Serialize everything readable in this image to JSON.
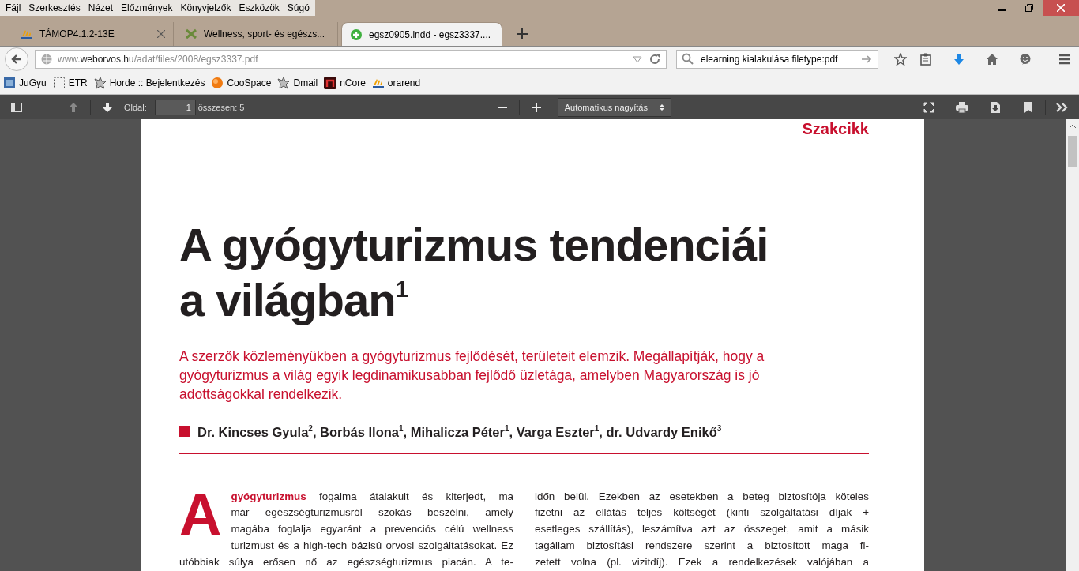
{
  "menu": [
    {
      "label": "Fájl"
    },
    {
      "label": "Szerkesztés"
    },
    {
      "label": "Nézet"
    },
    {
      "label": "Előzmények"
    },
    {
      "label": "Könyvjelzők"
    },
    {
      "label": "Eszközök"
    },
    {
      "label": "Súgó"
    }
  ],
  "tabs": [
    {
      "title": "TÁMOP4.1.2-13E",
      "kind": "pma",
      "selected": false
    },
    {
      "title": "Wellness, sport- és egészs...",
      "kind": "wellness",
      "selected": false
    },
    {
      "title": "egsz0905.indd - egsz3337....",
      "kind": "plus",
      "selected": true
    }
  ],
  "address": {
    "url": "www.**weborvos.hu**/adat/files/2008/egsz3337.pdf"
  },
  "search": {
    "value": "elearning kialakulása filetype:pdf"
  },
  "bookmarks": [
    {
      "label": "JuGyu",
      "kind": "square"
    },
    {
      "label": "ETR",
      "kind": "dashed"
    },
    {
      "label": "Horde :: Bejelentkezés",
      "kind": "star"
    },
    {
      "label": "CooSpace",
      "kind": "orb"
    },
    {
      "label": "Dmail",
      "kind": "star"
    },
    {
      "label": "nCore",
      "kind": "ncore"
    },
    {
      "label": "orarend",
      "kind": "pma"
    }
  ],
  "pdf_toolbar": {
    "page_label": "Oldal:",
    "page_value": "1",
    "page_total": "összesen: 5",
    "zoom": "Automatikus nagyítás"
  },
  "document": {
    "section": "Szakcikk",
    "title": [
      "A gyógyturizmus tendenciái",
      "a világban$^{1}$"
    ],
    "lede": "A szerzők közleményükben a gyógyturizmus fejlődését, területeit elemzik. Megállapítják, hogy a gyógyturizmus a világ egyik legdinamikusabban fejlődő üzletága, amelyben Magyarország is jó adottságokkal rendelkezik.",
    "authors": "Dr. Kincses Gyula$^{2}$, Borbás Ilona$^{1}$, Mihalicza Péter$^{1}$, Varga Eszter$^{1}$, dr. Udvardy Enikő$^{3}$",
    "drop_cap": "A",
    "left_lines": [
      "**gyógyturizmus** fogalma átalakult és kiterjedt, ma",
      "már egészségturizmusról szokás beszélni, amely",
      "magába foglalja egyaránt a prevenciós célú wellness",
      "turizmust és a high-tech bázisú orvosi szolgáltatásokat. Ez",
      "utóbbiak súlya erősen nő az egészségturizmus piacán. A te-"
    ],
    "right_lines": [
      "időn belül. Ezekben az esetekben a beteg biztosítója köteles",
      "fizetni az ellátás teljes költségét (kinti szolgáltatási díjak +",
      "esetleges szállítás), leszámítva azt az összeget, amit a másik",
      "tagállam biztosítási rendszere szerint a biztosított maga fi-",
      "zetett volna (pl. vizitdíj). Ezek a rendelkezések valójában a"
    ]
  }
}
